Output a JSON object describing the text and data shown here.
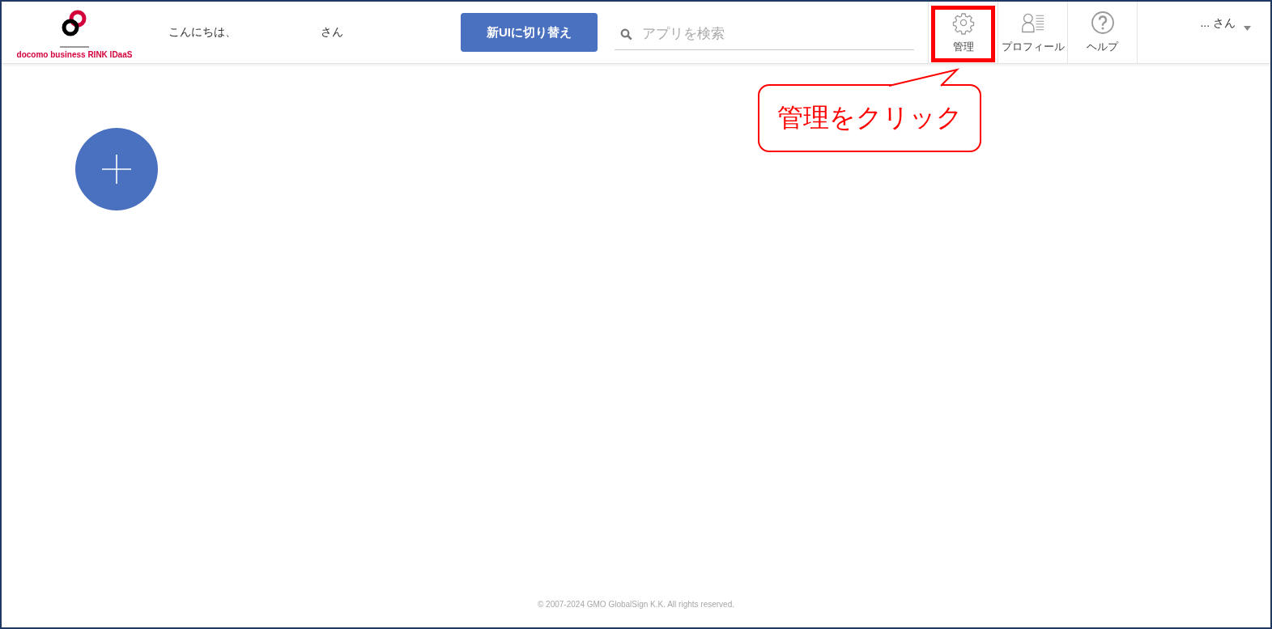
{
  "header": {
    "logo_text": "docomo business RINK IDaaS",
    "greeting": "こんにちは、",
    "greeting_suffix": "さん",
    "switch_button": "新UIに切り替え",
    "search": {
      "placeholder": "アプリを検索"
    },
    "nav": [
      {
        "kind": "gear",
        "label": "管理",
        "highlighted": true
      },
      {
        "kind": "profile",
        "label": "プロフィール",
        "highlighted": false
      },
      {
        "kind": "help",
        "label": "ヘルプ",
        "highlighted": false
      }
    ],
    "user": "... さん"
  },
  "callout": {
    "text": "管理をクリック"
  },
  "footer": "© 2007-2024 GMO GlobalSign K.K. All rights reserved."
}
